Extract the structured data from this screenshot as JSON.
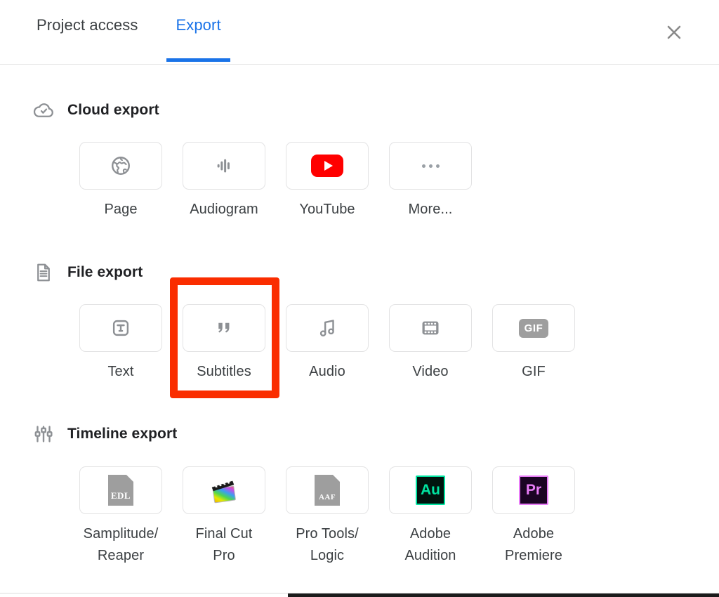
{
  "dialog": {
    "close_label": "Close",
    "close_icon": "close-icon"
  },
  "tabs": [
    {
      "label": "Project access",
      "active": false
    },
    {
      "label": "Export",
      "active": true
    }
  ],
  "colors": {
    "accent_blue": "#1a73e8",
    "highlight_red": "#fa2d00",
    "youtube_red": "#ff0000",
    "audition_green": "#00e4a1",
    "premiere_purple": "#e87cf7",
    "icon_gray": "#9aa0a6",
    "text_primary": "#202124",
    "text_secondary": "#3c4043",
    "card_border": "#e3e3e4"
  },
  "sections": [
    {
      "title": "Cloud export",
      "icon": "cloud-check-icon",
      "items": [
        {
          "label": "Page",
          "icon": "globe-icon"
        },
        {
          "label": "Audiogram",
          "icon": "waveform-icon"
        },
        {
          "label": "YouTube",
          "icon": "youtube-icon"
        },
        {
          "label": "More...",
          "icon": "more-horizontal-icon"
        }
      ]
    },
    {
      "title": "File export",
      "icon": "document-lines-icon",
      "items": [
        {
          "label": "Text",
          "icon": "text-box-icon"
        },
        {
          "label": "Subtitles",
          "icon": "quote-marks-icon",
          "highlighted": true
        },
        {
          "label": "Audio",
          "icon": "music-note-icon"
        },
        {
          "label": "Video",
          "icon": "film-strip-icon"
        },
        {
          "label": "GIF",
          "icon": "gif-badge-icon",
          "badge_text": "GIF"
        }
      ]
    },
    {
      "title": "Timeline export",
      "icon": "timeline-sliders-icon",
      "items": [
        {
          "label": "Samplitude/\nReaper",
          "icon": "edl-file-icon",
          "badge_text": "EDL"
        },
        {
          "label": "Final Cut\nPro",
          "icon": "final-cut-pro-icon"
        },
        {
          "label": "Pro Tools/\nLogic",
          "icon": "aaf-file-icon",
          "badge_text": "AAF"
        },
        {
          "label": "Adobe\nAudition",
          "icon": "adobe-audition-icon",
          "badge_text": "Au"
        },
        {
          "label": "Adobe\nPremiere",
          "icon": "adobe-premiere-icon",
          "badge_text": "Pr"
        }
      ]
    }
  ],
  "highlight": {
    "target_label": "Subtitles",
    "name": "subtitles-highlight-annotation"
  }
}
